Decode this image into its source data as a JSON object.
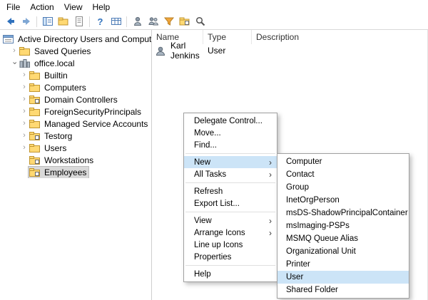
{
  "menubar": {
    "items": [
      "File",
      "Action",
      "View",
      "Help"
    ]
  },
  "toolbar": {
    "buttons": [
      {
        "name": "back-icon"
      },
      {
        "name": "forward-icon"
      },
      {
        "name": "show-console-tree-icon"
      },
      {
        "name": "up-one-level-icon"
      },
      {
        "name": "properties-icon"
      },
      {
        "name": "help-icon"
      },
      {
        "name": "export-list-icon"
      },
      {
        "name": "create-user-icon"
      },
      {
        "name": "create-group-icon"
      },
      {
        "name": "filter-icon"
      },
      {
        "name": "create-ou-icon"
      },
      {
        "name": "find-icon"
      }
    ],
    "help_glyph": "?"
  },
  "tree": {
    "items": [
      {
        "label": "Active Directory Users and Computers [IdVauMUj",
        "depth": 0,
        "icon": "console-root",
        "chevron": "none",
        "selected": false
      },
      {
        "label": "Saved Queries",
        "depth": 1,
        "icon": "folder",
        "chevron": "collapsed",
        "selected": false
      },
      {
        "label": "office.local",
        "depth": 1,
        "icon": "domain",
        "chevron": "expanded",
        "selected": false
      },
      {
        "label": "Builtin",
        "depth": 2,
        "icon": "folder",
        "chevron": "collapsed",
        "selected": false
      },
      {
        "label": "Computers",
        "depth": 2,
        "icon": "folder",
        "chevron": "collapsed",
        "selected": false
      },
      {
        "label": "Domain Controllers",
        "depth": 2,
        "icon": "ou",
        "chevron": "collapsed",
        "selected": false
      },
      {
        "label": "ForeignSecurityPrincipals",
        "depth": 2,
        "icon": "folder",
        "chevron": "collapsed",
        "selected": false
      },
      {
        "label": "Managed Service Accounts",
        "depth": 2,
        "icon": "folder",
        "chevron": "collapsed",
        "selected": false
      },
      {
        "label": "Testorg",
        "depth": 2,
        "icon": "ou",
        "chevron": "collapsed",
        "selected": false
      },
      {
        "label": "Users",
        "depth": 2,
        "icon": "folder",
        "chevron": "collapsed",
        "selected": false
      },
      {
        "label": "Workstations",
        "depth": 2,
        "icon": "ou",
        "chevron": "none",
        "selected": false
      },
      {
        "label": "Employees",
        "depth": 2,
        "icon": "ou",
        "chevron": "none",
        "selected": true
      }
    ]
  },
  "list": {
    "columns": [
      "Name",
      "Type",
      "Description"
    ],
    "rows": [
      {
        "name": "Karl Jenkins",
        "type": "User",
        "description": "",
        "icon": "user-icon"
      }
    ]
  },
  "context_menu": {
    "items": [
      {
        "label": "Delegate Control...",
        "type": "item"
      },
      {
        "label": "Move...",
        "type": "item"
      },
      {
        "label": "Find...",
        "type": "item"
      },
      {
        "type": "separator"
      },
      {
        "label": "New",
        "type": "item",
        "submenu": true,
        "highlighted": true
      },
      {
        "label": "All Tasks",
        "type": "item",
        "submenu": true
      },
      {
        "type": "separator"
      },
      {
        "label": "Refresh",
        "type": "item"
      },
      {
        "label": "Export List...",
        "type": "item"
      },
      {
        "type": "separator"
      },
      {
        "label": "View",
        "type": "item",
        "submenu": true
      },
      {
        "label": "Arrange Icons",
        "type": "item",
        "submenu": true
      },
      {
        "label": "Line up Icons",
        "type": "item"
      },
      {
        "label": "Properties",
        "type": "item"
      },
      {
        "type": "separator"
      },
      {
        "label": "Help",
        "type": "item"
      }
    ]
  },
  "submenu": {
    "items": [
      "Computer",
      "Contact",
      "Group",
      "InetOrgPerson",
      "msDS-ShadowPrincipalContainer",
      "msImaging-PSPs",
      "MSMQ Queue Alias",
      "Organizational Unit",
      "Printer",
      "User",
      "Shared Folder"
    ],
    "highlighted": "User"
  },
  "colors": {
    "menu_highlight": "#cce4f7",
    "tree_selection_bg": "#d9d9d9",
    "menu_border": "#a0a0a0",
    "folder_fill": "#ffd973",
    "accent_blue": "#2f71bd"
  }
}
